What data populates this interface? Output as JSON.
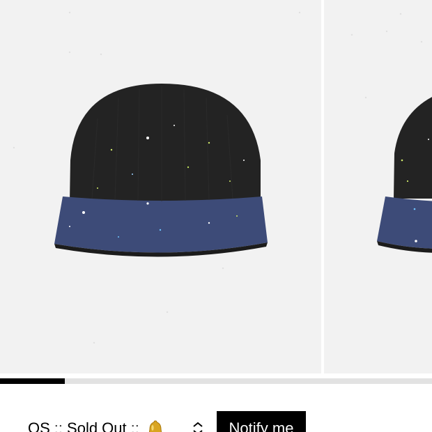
{
  "carousel": {
    "slides": [
      {
        "image": "beanie-front-product-photo"
      },
      {
        "image": "beanie-alt-product-photo"
      }
    ],
    "progress": 0.15
  },
  "purchase": {
    "size": "OS",
    "separator_1": "::",
    "availability": "Sold Out",
    "separator_2": "::",
    "bell_icon": "bell-icon",
    "select_icon": "chevron-updown-icon",
    "notify_label": "Notify me"
  },
  "colors": {
    "slide_background": "#f2f2f2",
    "beanie_body": "#222222",
    "beanie_band": "#3d4b78",
    "progress_fill": "#000000",
    "progress_track": "#e2e2e2",
    "button_bg": "#000000",
    "button_text": "#ffffff"
  }
}
